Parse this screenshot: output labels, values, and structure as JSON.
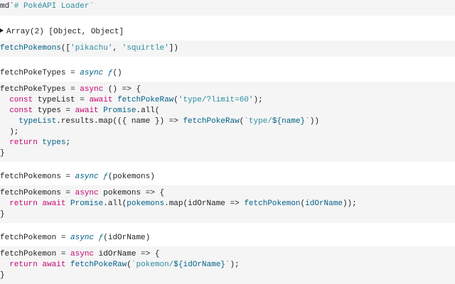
{
  "cells": {
    "md_title": {
      "prefix": "md`",
      "text": "# PokéAPI Loader",
      "suffix": "`"
    },
    "array_output": {
      "text": "Array(2) [Object, Object]"
    },
    "fetch_call": {
      "fn": "fetchPokemons",
      "open": "([",
      "arg1": "'pikachu'",
      "comma": ", ",
      "arg2": "'squirtle'",
      "close": "])"
    },
    "poketypes_output": {
      "name": "fetchPokeTypes = ",
      "kw": "async",
      "f": " ƒ",
      "rest": "()"
    },
    "poketypes_code": {
      "l1_name": "fetchPokeTypes = ",
      "l1_kw": "async",
      "l1_rest": " () => {",
      "l2_indent": "  ",
      "l2_const": "const",
      "l2_mid": " typeList = ",
      "l2_await": "await",
      "l2_sp": " ",
      "l2_fn": "fetchPokeRaw",
      "l2_open": "(",
      "l2_str": "'type/?limit=60'",
      "l2_close": ");",
      "l3_indent": "  ",
      "l3_const": "const",
      "l3_mid": " types = ",
      "l3_await": "await",
      "l3_sp": " ",
      "l3_fn": "Promise",
      "l3_rest": ".all(",
      "l4_indent": "    ",
      "l4_fn": "typeList",
      "l4_mid": ".results.map(({ name }) => ",
      "l4_fn2": "fetchPokeRaw",
      "l4_open": "(",
      "l4_tmpl1": "`type/",
      "l4_tmpl2": "${name}",
      "l4_tmpl3": "`",
      "l4_close": "))",
      "l5": "  );",
      "l6_indent": "  ",
      "l6_ret": "return",
      "l6_sp": " ",
      "l6_fn": "types",
      "l6_semi": ";",
      "l7": "}"
    },
    "pokemons_output": {
      "name": "fetchPokemons = ",
      "kw": "async",
      "f": " ƒ",
      "rest": "(pokemons)"
    },
    "pokemons_code": {
      "l1_name": "fetchPokemons = ",
      "l1_kw": "async",
      "l1_rest": " pokemons => {",
      "l2_indent": "  ",
      "l2_ret": "return",
      "l2_sp": " ",
      "l2_await": "await",
      "l2_sp2": " ",
      "l2_fn": "Promise",
      "l2_mid": ".all(",
      "l2_fn2": "pokemons",
      "l2_mid2": ".map(idOrName => ",
      "l2_fn3": "fetchPokemon",
      "l2_open": "(",
      "l2_fn4": "idOrName",
      "l2_close": "));",
      "l3": "}"
    },
    "pokemon_output": {
      "name": "fetchPokemon = ",
      "kw": "async",
      "f": " ƒ",
      "rest": "(idOrName)"
    },
    "pokemon_code": {
      "l1_name": "fetchPokemon = ",
      "l1_kw": "async",
      "l1_rest": " idOrName => {",
      "l2_indent": "  ",
      "l2_ret": "return",
      "l2_sp": " ",
      "l2_await": "await",
      "l2_sp2": " ",
      "l2_fn": "fetchPokeRaw",
      "l2_open": "(",
      "l2_tmpl1": "`pokemon/",
      "l2_tmpl2": "${idOrName}",
      "l2_tmpl3": "`",
      "l2_close": ");",
      "l3": "}"
    }
  }
}
